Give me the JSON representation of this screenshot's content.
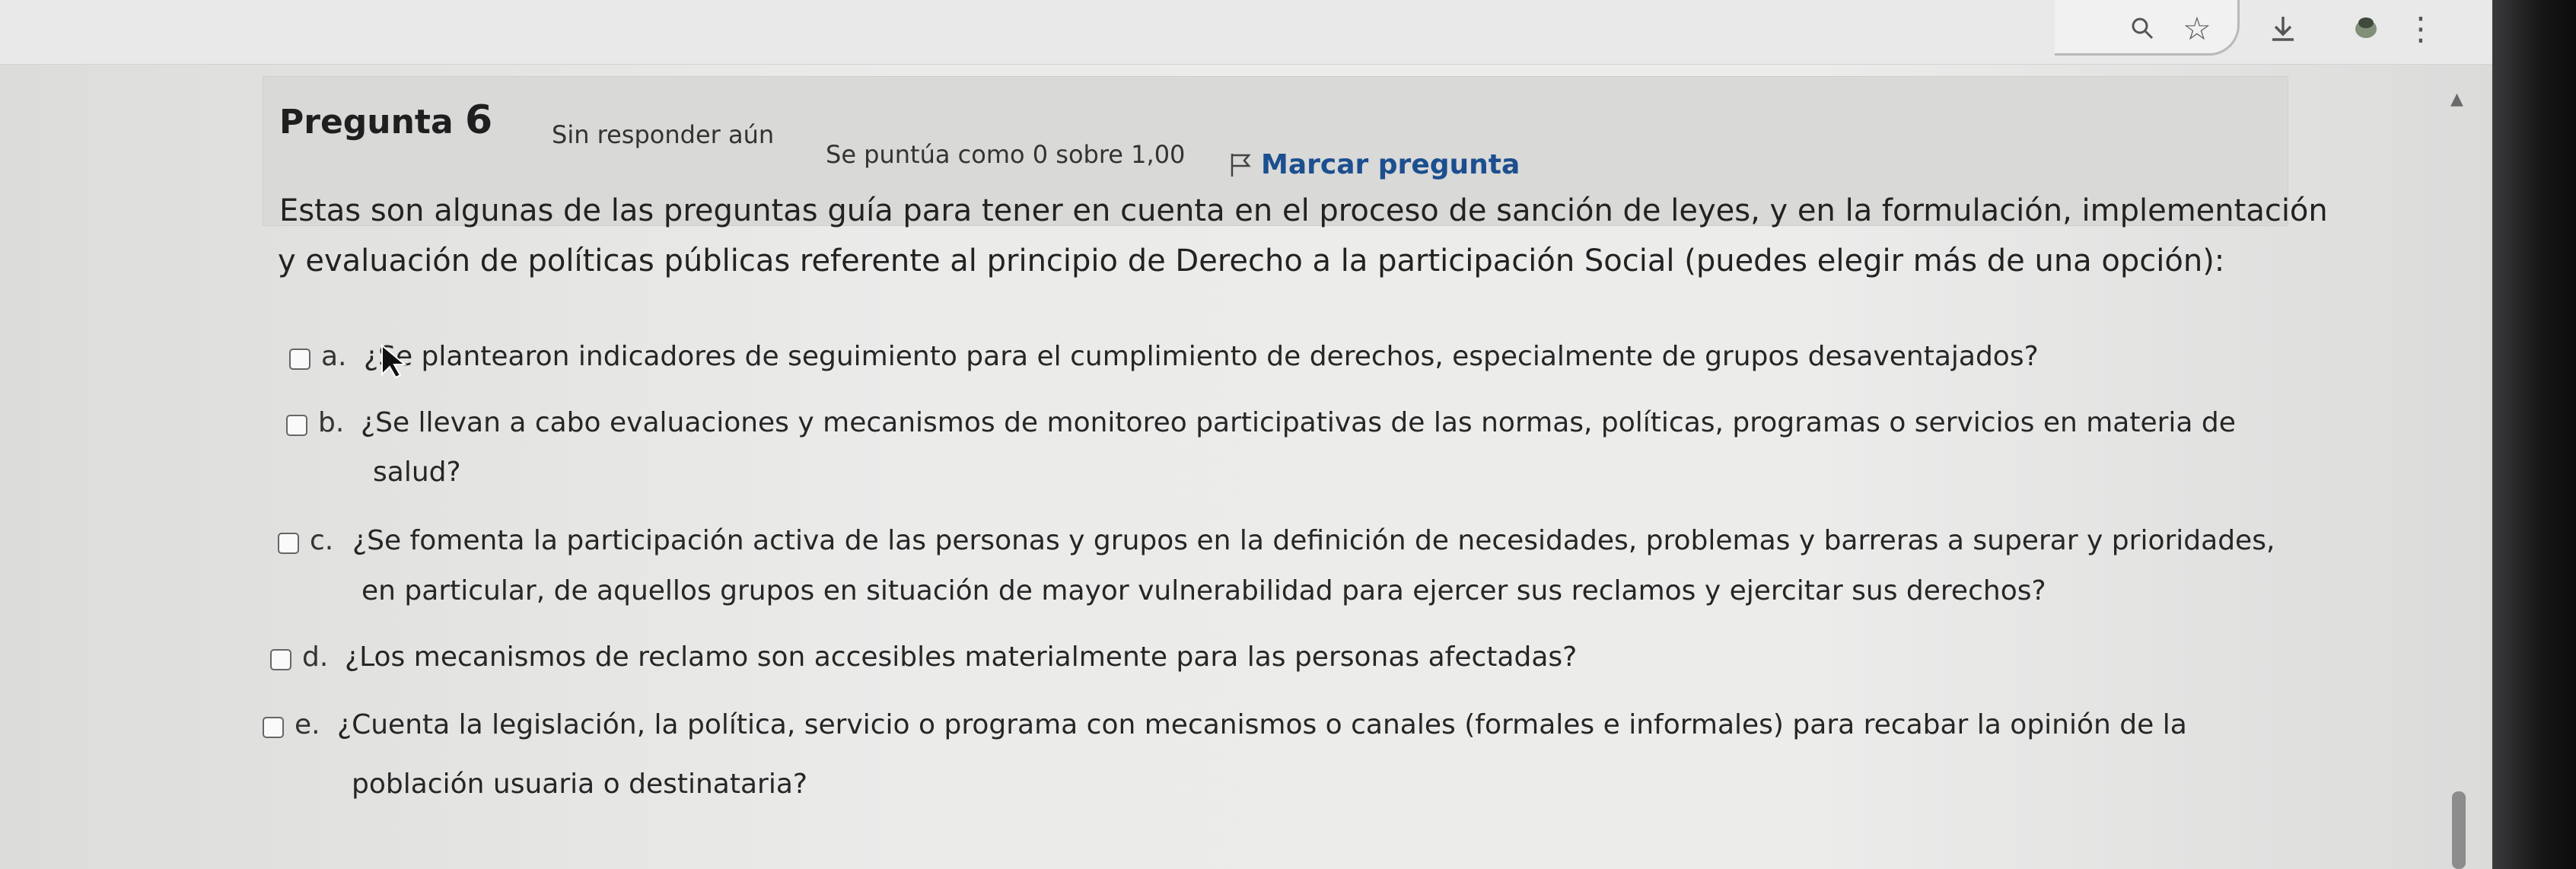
{
  "question": {
    "title": "Pregunta",
    "number": "6",
    "status": "Sin responder aún",
    "grade": "Se puntúa como 0 sobre 1,00",
    "flag_label": "Marcar pregunta",
    "text_lines": [
      "Estas son algunas de las preguntas guía para tener en cuenta en el proceso de sanción de leyes, y en la formulación, implementación",
      "y evaluación de políticas públicas referente al principio de Derecho a la participación Social (puedes elegir más de una opción):"
    ]
  },
  "options": [
    {
      "letter": "a.",
      "lines": [
        "¿Se plantearon indicadores de seguimiento para el cumplimiento de derechos, especialmente de grupos desaventajados?"
      ],
      "checked": false
    },
    {
      "letter": "b.",
      "lines": [
        "¿Se llevan a cabo evaluaciones y mecanismos de monitoreo participativas de las normas, políticas, programas o servicios en materia de",
        "salud?"
      ],
      "checked": false
    },
    {
      "letter": "c.",
      "lines": [
        "¿Se fomenta la participación activa de las personas y grupos en la definición de necesidades, problemas y barreras a superar y prioridades,",
        "en particular, de aquellos grupos en situación de mayor vulnerabilidad para ejercer sus reclamos y ejercitar sus derechos?"
      ],
      "checked": false
    },
    {
      "letter": "d.",
      "lines": [
        "¿Los mecanismos de reclamo son accesibles materialmente para las personas afectadas?"
      ],
      "checked": false
    },
    {
      "letter": "e.",
      "lines": [
        "¿Cuenta la legislación, la política, servicio o programa con mecanismos o canales (formales e informales) para recabar la opinión de la",
        "población usuaria o destinataria?"
      ],
      "checked": false
    }
  ],
  "toolbar_icons": [
    "zoom-icon",
    "star-icon",
    "download-icon",
    "extension-icon",
    "menu-icon"
  ]
}
